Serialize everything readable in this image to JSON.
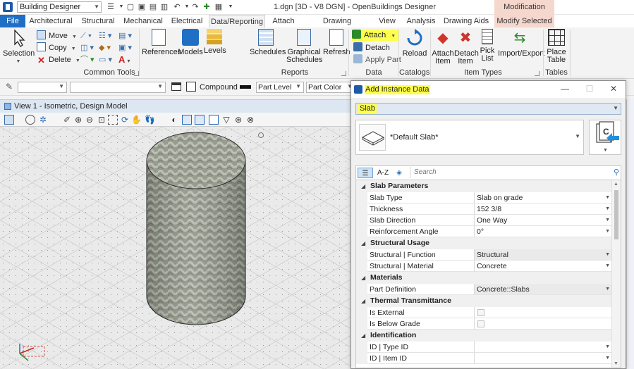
{
  "titlebar": {
    "workflow": "Building Designer",
    "window_title": "1.dgn [3D - V8 DGN] - OpenBuildings Designer",
    "context_group": "Modification"
  },
  "ribbon_tabs": [
    "File",
    "Architectural",
    "Structural",
    "Mechanical",
    "Electrical",
    "Data/Reporting",
    "Attach",
    "Drawing Production",
    "View",
    "Analysis",
    "Drawing Aids",
    "Modify Selected"
  ],
  "ribbon": {
    "common_tools": {
      "label": "Common Tools",
      "selection": "Selection",
      "move": "Move",
      "copy": "Copy",
      "delete": "Delete"
    },
    "reports": {
      "label": "Reports",
      "references": "References",
      "models": "Models",
      "levels": "Levels",
      "schedules": "Schedules",
      "graphical_schedules": [
        "Graphical",
        "Schedules"
      ],
      "refresh": "Refresh"
    },
    "data": {
      "label": "Data",
      "attach": "Attach",
      "detach": "Detach",
      "apply_part": "Apply Part"
    },
    "catalogs": {
      "label": "Catalogs",
      "reload": "Reload"
    },
    "item_types": {
      "label": "Item Types",
      "attach_item": [
        "Attach",
        "Item"
      ],
      "detach_item": [
        "Detach",
        "Item"
      ],
      "pick_list": [
        "Pick",
        "List"
      ],
      "import_export": "Import/Export"
    },
    "tables": {
      "label": "Tables",
      "place_table": [
        "Place",
        "Table"
      ]
    }
  },
  "attrbar": {
    "compound": "Compound",
    "part_level": "Part Level",
    "part_color": "Part Color"
  },
  "view": {
    "title": "View 1 - Isometric, Design Model"
  },
  "dialog": {
    "title": "Add Instance Data",
    "type_value": "Slab",
    "definition": "*Default Slab*",
    "search_placeholder": "Search",
    "az_label": "A-Z",
    "categories": [
      {
        "name": "Slab Parameters",
        "props": [
          {
            "name": "Slab Type",
            "value": "Slab on grade",
            "dropdown": true
          },
          {
            "name": "Thickness",
            "value": "152 3/8",
            "dropdown": true
          },
          {
            "name": "Slab Direction",
            "value": "One Way",
            "dropdown": true
          },
          {
            "name": "Reinforcement Angle",
            "value": "0°",
            "dropdown": true
          }
        ]
      },
      {
        "name": "Structural Usage",
        "props": [
          {
            "name": "Structural | Function",
            "value": "Structural",
            "dropdown": true,
            "readonly": true
          },
          {
            "name": "Structural | Material",
            "value": "Concrete",
            "dropdown": true
          }
        ]
      },
      {
        "name": "Materials",
        "props": [
          {
            "name": "Part Definition",
            "value": "Concrete::Slabs",
            "dropdown": true,
            "readonly": true
          }
        ]
      },
      {
        "name": "Thermal Transmittance",
        "props": [
          {
            "name": "Is External",
            "value": "",
            "checkbox": true
          },
          {
            "name": "Is Below Grade",
            "value": "",
            "checkbox": true
          }
        ]
      },
      {
        "name": "Identification",
        "props": [
          {
            "name": "ID | Type ID",
            "value": "",
            "dropdown": true
          },
          {
            "name": "ID | Item ID",
            "value": "",
            "dropdown": true
          }
        ]
      }
    ]
  },
  "colors": {
    "file_tab": "#1f6fc5",
    "context_tab": "#f6d7cd",
    "highlight": "#ffff4d"
  }
}
